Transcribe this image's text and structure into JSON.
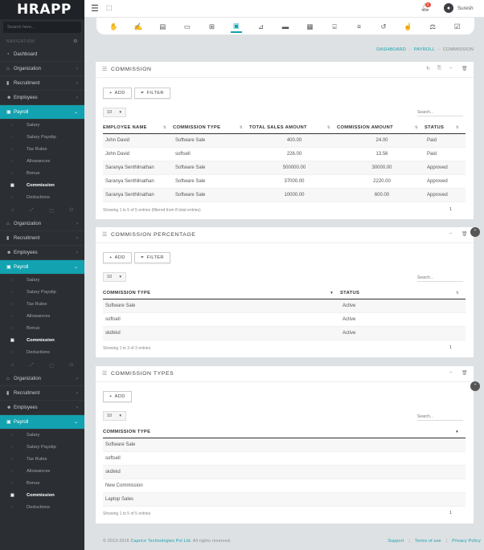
{
  "app": {
    "logo": "HRAPP"
  },
  "sidebar": {
    "search_placeholder": "Search here...",
    "nav_header": "NAVIGATION",
    "groups": [
      {
        "items": [
          {
            "label": "Dashboard"
          },
          {
            "label": "Organization"
          },
          {
            "label": "Recruitment"
          },
          {
            "label": "Employees"
          },
          {
            "label": "Payroll"
          }
        ],
        "sub_items": [
          {
            "label": "Salary"
          },
          {
            "label": "Salary Payslip"
          },
          {
            "label": "Tax Rules"
          },
          {
            "label": "Allowances"
          },
          {
            "label": "Bonus"
          },
          {
            "label": "Commission"
          },
          {
            "label": "Deductions"
          }
        ]
      },
      {
        "items": [
          {
            "label": "Organization"
          },
          {
            "label": "Recruitment"
          },
          {
            "label": "Employees"
          },
          {
            "label": "Payroll"
          }
        ],
        "sub_items": [
          {
            "label": "Salary"
          },
          {
            "label": "Salary Payslip"
          },
          {
            "label": "Tax Rules"
          },
          {
            "label": "Allowances"
          },
          {
            "label": "Bonus"
          },
          {
            "label": "Commission"
          },
          {
            "label": "Deductions"
          }
        ]
      },
      {
        "items": [
          {
            "label": "Organization"
          },
          {
            "label": "Recruitment"
          },
          {
            "label": "Employees"
          },
          {
            "label": "Payroll"
          }
        ],
        "sub_items": [
          {
            "label": "Salary"
          },
          {
            "label": "Salary Payslip"
          },
          {
            "label": "Tax Rules"
          },
          {
            "label": "Allowances"
          },
          {
            "label": "Bonus"
          },
          {
            "label": "Commission"
          },
          {
            "label": "Deductions"
          }
        ]
      }
    ]
  },
  "topbar": {
    "notification_count": "2",
    "user_name": "Suresh"
  },
  "breadcrumb": {
    "items": [
      "DASHBOARD",
      "PAYROLL",
      "COMMISSION"
    ]
  },
  "buttons": {
    "add": "ADD",
    "filter": "FILTER"
  },
  "page_length": "10",
  "search_placeholder": "Search...",
  "commission": {
    "title": "COMMISSION",
    "columns": [
      "EMPLOYEE NAME",
      "COMMISSION TYPE",
      "TOTAL SALES AMOUNT",
      "COMMISSION AMOUNT",
      "STATUS"
    ],
    "rows": [
      [
        "John David",
        "Software Sale",
        "400.00",
        "24.00",
        "Paid"
      ],
      [
        "John David",
        "softsell",
        "226.00",
        "13.56",
        "Paid"
      ],
      [
        "Saranya Senthilnathan",
        "Software Sale",
        "500000.00",
        "30000.00",
        "Approved"
      ],
      [
        "Saranya Senthilnathan",
        "Software Sale",
        "37000.00",
        "2220.00",
        "Approved"
      ],
      [
        "Saranya Senthilnathan",
        "Software Sale",
        "10000.00",
        "600.00",
        "Approved"
      ]
    ],
    "info": "Showing 1 to 5 of 5 entries (filtered from 8 total entries)",
    "page": "1"
  },
  "commission_percentage": {
    "title": "COMMISSION PERCENTAGE",
    "columns": [
      "COMMISSION TYPE",
      "STATUS"
    ],
    "rows": [
      [
        "Software Sale",
        "Active"
      ],
      [
        "softsell",
        "Active"
      ],
      [
        "skdkkd",
        "Active"
      ]
    ],
    "info": "Showing 1 to 3 of 3 entries",
    "page": "1"
  },
  "commission_types": {
    "title": "COMMISSION TYPES",
    "columns": [
      "COMMISSION TYPE"
    ],
    "rows": [
      [
        "Software Sale"
      ],
      [
        "softsell"
      ],
      [
        "skdkkd"
      ],
      [
        "New Commission"
      ],
      [
        "Laptop Sales"
      ]
    ],
    "info": "Showing 1 to 5 of 5 entries",
    "page": "1"
  },
  "footer": {
    "copyright_prefix": "© 2013-2016",
    "company": "Caprice Technologies Pvt Ltd.",
    "copyright_suffix": "All rights reserved.",
    "links": [
      "Support",
      "Terms of use",
      "Privacy Policy"
    ]
  },
  "colors": {
    "accent": "#12a2b0",
    "sidebar_bg": "#2b2f33",
    "logo_bg": "#1f2226",
    "badge": "#e74c3c"
  },
  "icons": {
    "toolbar": [
      "hand-money-icon",
      "document-signature-icon",
      "document-check-icon",
      "briefcase-icon",
      "gift-icon",
      "commission-icon",
      "handshake-icon",
      "ticket-icon",
      "certificate-icon",
      "cash-register-icon",
      "list-icon",
      "history-icon",
      "hand-icon",
      "scale-icon",
      "checklist-icon"
    ]
  }
}
